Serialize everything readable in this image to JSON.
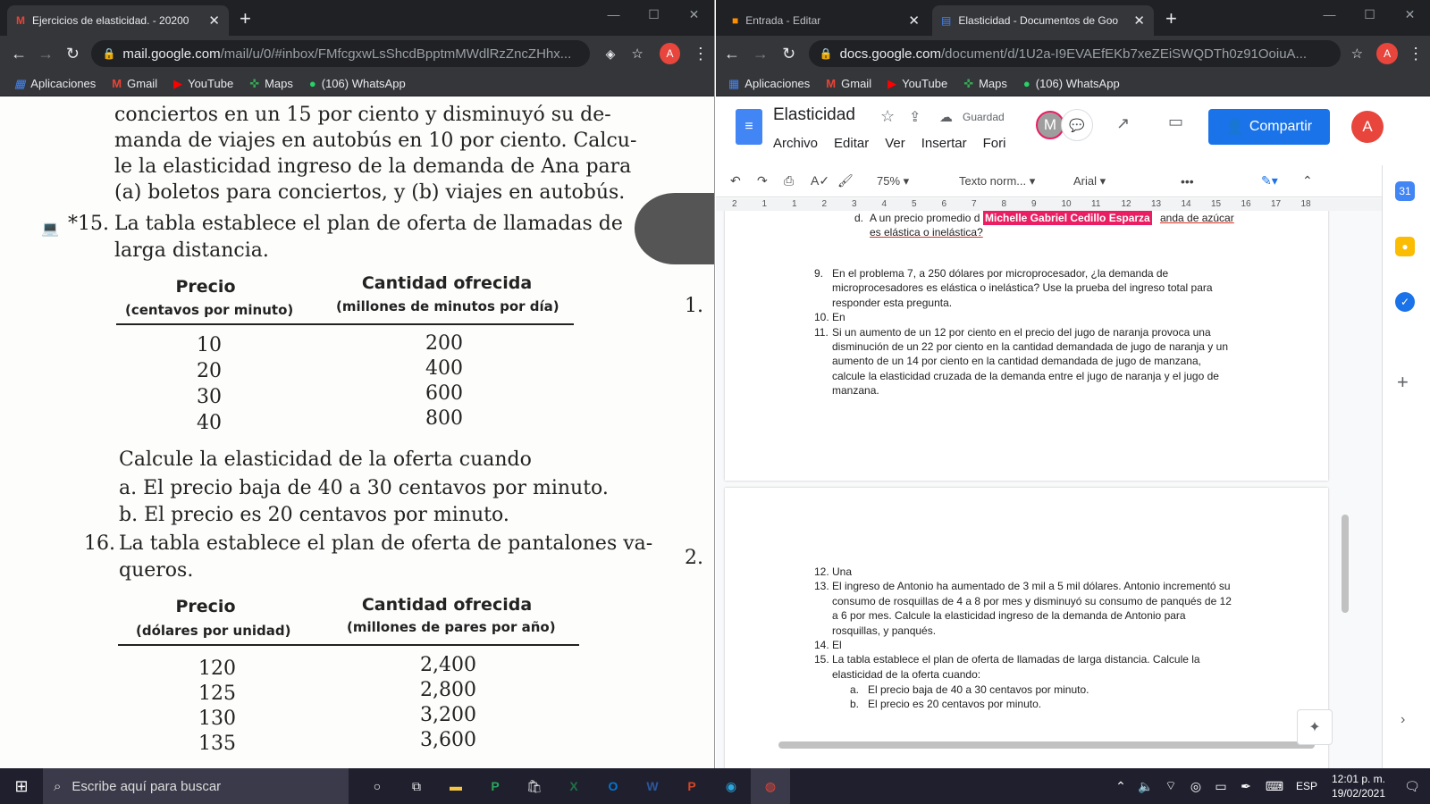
{
  "left_browser": {
    "tab_title": "Ejercicios de elasticidad. - 20200",
    "url_host": "mail.google.com",
    "url_path": "/mail/u/0/#inbox/FMfcgxwLsShcdBpptmMWdlRzZncZHhx...",
    "avatar": "A",
    "bookmarks": [
      "Aplicaciones",
      "Gmail",
      "YouTube",
      "Maps",
      "(106) WhatsApp"
    ]
  },
  "scan": {
    "lines": [
      "conciertos en un 15 por ciento y disminuyó su de-",
      "manda de viajes en autobús en 10 por ciento. Calcu-",
      "le la elasticidad ingreso de la demanda de Ana para",
      "(a) boletos para conciertos, y (b) viajes en autobús."
    ],
    "p15_num": "*15.",
    "p15_line1": "La tabla establece el plan de oferta de llamadas de",
    "p15_line2": "larga distancia.",
    "t1_h1": "Precio",
    "t1_h1s": "(centavos por minuto)",
    "t1_h2": "Cantidad ofrecida",
    "t1_h2s": "(millones de minutos por día)",
    "t1_prices": [
      "10",
      "20",
      "30",
      "40"
    ],
    "t1_qty": [
      "200",
      "400",
      "600",
      "800"
    ],
    "calc": "Calcule la elasticidad de la oferta cuando",
    "calc_a": "a.  El precio baja de 40 a 30 centavos por minuto.",
    "calc_b": "b.  El precio es 20 centavos por minuto.",
    "p16_num": "16.",
    "p16_line1": "La tabla establece el plan de oferta de pantalones va-",
    "p16_line2": "queros.",
    "t2_h1": "Precio",
    "t2_h1s": "(dólares por unidad)",
    "t2_h2": "Cantidad ofrecida",
    "t2_h2s": "(millones de pares por año)",
    "t2_prices": [
      "120",
      "125",
      "130",
      "135"
    ],
    "t2_qty": [
      "2,400",
      "2,800",
      "3,200",
      "3,600"
    ],
    "margin1": "1.",
    "margin2": "2."
  },
  "right_browser": {
    "tab1_title": "Entrada - Editar",
    "tab2_title": "Elasticidad - Documentos de Goo",
    "url_host": "docs.google.com",
    "url_path": "/document/d/1U2a-I9EVAEfEKb7xeZEiSWQDTh0z91OoiuA...",
    "avatar": "A",
    "bookmarks": [
      "Aplicaciones",
      "Gmail",
      "YouTube",
      "Maps",
      "(106) WhatsApp"
    ]
  },
  "docs": {
    "title": "Elasticidad",
    "saved": "Guardad",
    "menus": [
      "Archivo",
      "Editar",
      "Ver",
      "Insertar",
      "Fori"
    ],
    "collab_initial": "M",
    "share": "Compartir",
    "user_initial": "A",
    "zoom": "75%",
    "style": "Texto norm...",
    "font": "Arial",
    "ruler": [
      "2",
      "1",
      "1",
      "2",
      "3",
      "4",
      "5",
      "6",
      "7",
      "8",
      "9",
      "10",
      "11",
      "12",
      "13",
      "14",
      "15",
      "16",
      "17",
      "18"
    ],
    "cursor_label": "Michelle Gabriel Cedillo Esparza",
    "p1": [
      {
        "n": "d.",
        "t": "A un precio promedio d",
        "t2": "anda de azúcar"
      },
      {
        "n": "",
        "t": "es elástica o inelástica?"
      }
    ],
    "items1": [
      {
        "n": "9.",
        "lines": [
          "En el problema 7, a 250 dólares por microprocesador, ¿la demanda de",
          "microprocesadores es elástica o inelástica? Use la prueba del ingreso total para",
          "responder esta pregunta."
        ]
      },
      {
        "n": "10.",
        "lines": [
          "En"
        ]
      },
      {
        "n": "11.",
        "lines": [
          "Si un aumento de un 12 por ciento en el precio del jugo de naranja provoca una",
          "disminución de un 22 por ciento en la cantidad demandada de jugo de naranja y un",
          "aumento de un 14 por ciento en la cantidad demandada de jugo de manzana,",
          "calcule la elasticidad cruzada de la demanda entre el jugo de naranja y el jugo de",
          "manzana."
        ]
      }
    ],
    "items2": [
      {
        "n": "12.",
        "lines": [
          "Una"
        ]
      },
      {
        "n": "13.",
        "lines": [
          "El ingreso de Antonio ha aumentado de 3 mil a 5 mil dólares. Antonio incrementó su",
          "consumo de rosquillas de 4 a 8 por mes y disminuyó su consumo de panqués de 12",
          "a 6 por mes. Calcule la elasticidad ingreso de la demanda de Antonio para",
          "rosquillas, y panqués."
        ]
      },
      {
        "n": "14.",
        "lines": [
          "El"
        ]
      },
      {
        "n": "15.",
        "lines": [
          "La tabla establece el plan de oferta de llamadas de larga distancia. Calcule la",
          "elasticidad de la oferta cuando:"
        ]
      }
    ],
    "sub15": [
      {
        "n": "a.",
        "t": "El precio baja de 40 a 30 centavos por minuto."
      },
      {
        "n": "b.",
        "t": "El precio es 20 centavos por minuto."
      }
    ]
  },
  "taskbar": {
    "search": "Escribe aquí para buscar",
    "lang": "ESP",
    "time": "12:01 p. m.",
    "date": "19/02/2021"
  }
}
